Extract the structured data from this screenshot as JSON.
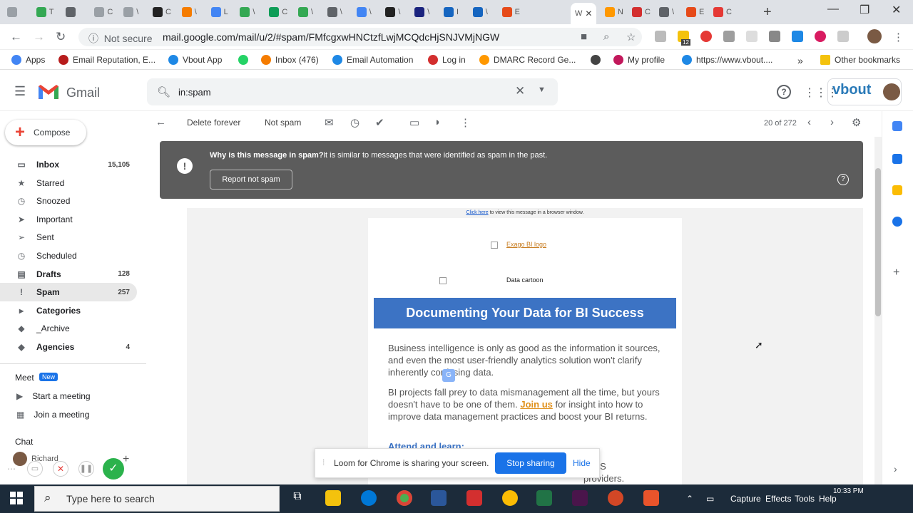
{
  "browser": {
    "tabs": [
      {
        "label": "",
        "color": "#9aa0a6"
      },
      {
        "label": "T",
        "color": "#34a853"
      },
      {
        "label": "",
        "color": "#5f6368"
      },
      {
        "label": "C",
        "color": "#9aa0a6"
      },
      {
        "label": "\\",
        "color": "#9aa0a6"
      },
      {
        "label": "C",
        "color": "#222222"
      },
      {
        "label": "\\",
        "color": "#f57c00"
      },
      {
        "label": "L",
        "color": "#4285f4"
      },
      {
        "label": "\\",
        "color": "#34a853"
      },
      {
        "label": "C",
        "color": "#0f9d58"
      },
      {
        "label": "\\",
        "color": "#34a853"
      },
      {
        "label": "\\",
        "color": "#5f6368"
      },
      {
        "label": "\\",
        "color": "#4285f4"
      },
      {
        "label": "\\",
        "color": "#222222"
      },
      {
        "label": "\\",
        "color": "#1a237e"
      },
      {
        "label": "I",
        "color": "#1565c0"
      },
      {
        "label": "\\",
        "color": "#1565c0"
      },
      {
        "label": "E",
        "color": "#e64a19"
      }
    ],
    "active_tab": {
      "label": "W",
      "close": "✕"
    },
    "tabs_after": [
      {
        "label": "N",
        "color": "#ff9800"
      },
      {
        "label": "C",
        "color": "#d32f2f"
      },
      {
        "label": "\\",
        "color": "#5f6368"
      },
      {
        "label": "E",
        "color": "#e64a19"
      },
      {
        "label": "C",
        "color": "#e53935"
      }
    ],
    "new_tab": "+",
    "window_controls": {
      "minimize": "—",
      "restore": "❐",
      "close": "✕"
    },
    "not_secure": "Not secure",
    "url": "mail.google.com/mail/u/2/#spam/FMfcgxwHNCtzfLwjMCQdcHjSNJVMjNGW",
    "extension_badge": "12",
    "bookmarks": [
      {
        "label": "Apps",
        "color": "#4285f4"
      },
      {
        "label": "Email Reputation, E...",
        "color": "#b71c1c"
      },
      {
        "label": "Vbout App",
        "color": "#1e88e5"
      },
      {
        "label": "",
        "color": "#25d366"
      },
      {
        "label": "Inbox (476)",
        "color": "#f57c00"
      },
      {
        "label": "Email Automation",
        "color": "#1e88e5"
      },
      {
        "label": "Log in",
        "color": "#d32f2f"
      },
      {
        "label": "DMARC Record Ge...",
        "color": "#ff9800"
      },
      {
        "label": "",
        "color": "#444444"
      },
      {
        "label": "My profile",
        "color": "#c2185b"
      },
      {
        "label": "https://www.vbout....",
        "color": "#1e88e5"
      }
    ],
    "bookmarks_more": "»",
    "other_bookmarks": "Other bookmarks"
  },
  "gmail": {
    "title": "Gmail",
    "search_value": "in:spam",
    "brand": "vbout",
    "compose": "Compose",
    "nav": [
      {
        "label": "Inbox",
        "count": "15,105",
        "icon": "▭",
        "bold": true
      },
      {
        "label": "Starred",
        "count": "",
        "icon": "★",
        "bold": false
      },
      {
        "label": "Snoozed",
        "count": "",
        "icon": "◷",
        "bold": false
      },
      {
        "label": "Important",
        "count": "",
        "icon": "➤",
        "bold": false
      },
      {
        "label": "Sent",
        "count": "",
        "icon": "➢",
        "bold": false
      },
      {
        "label": "Scheduled",
        "count": "",
        "icon": "◷",
        "bold": false
      },
      {
        "label": "Drafts",
        "count": "128",
        "icon": "▤",
        "bold": true
      },
      {
        "label": "Spam",
        "count": "257",
        "icon": "!",
        "bold": true
      },
      {
        "label": "Categories",
        "count": "",
        "icon": "▸",
        "bold": true
      },
      {
        "label": "_Archive",
        "count": "",
        "icon": "◆",
        "bold": false
      },
      {
        "label": "Agencies",
        "count": "4",
        "icon": "◆",
        "bold": true
      }
    ],
    "meet_label": "Meet",
    "meet_new": "New",
    "meet_items": [
      "Start a meeting",
      "Join a meeting"
    ],
    "chat_label": "Chat",
    "chat_user": "Richard",
    "toolbar": {
      "delete_forever": "Delete forever",
      "not_spam": "Not spam",
      "count": "20 of 272"
    },
    "warning": {
      "title": "Why is this message in spam?",
      "text": "It is similar to messages that were identified as spam in the past.",
      "button": "Report not spam"
    },
    "email": {
      "link_text": "Click here",
      "link_rest": "to view this message in a browser window.",
      "logo_alt": "Exago BI logo",
      "cartoon_alt": "Data cartoon",
      "banner": "Documenting Your Data for BI Success",
      "para1": "Business intelligence is only as good as the information it sources, and even the most user-friendly analytics solution won't clarify inherently confusing data.",
      "para2_a": "BI projects fall prey to data mismanagement all the time, but yours doesn't have to be one of them.",
      "para2_link": "Join us",
      "para2_b": "for insight into how to improve data management practices and boost your BI returns.",
      "attend": "Attend and learn:",
      "saas": "SaaS providers."
    }
  },
  "loom": {
    "text": "Loom for Chrome is sharing your screen.",
    "stop": "Stop sharing",
    "hide": "Hide"
  },
  "taskbar": {
    "search_placeholder": "Type here to search",
    "tray_items": [
      "Capture",
      "Effects",
      "Tools",
      "Help"
    ],
    "time": "10:33 PM"
  }
}
